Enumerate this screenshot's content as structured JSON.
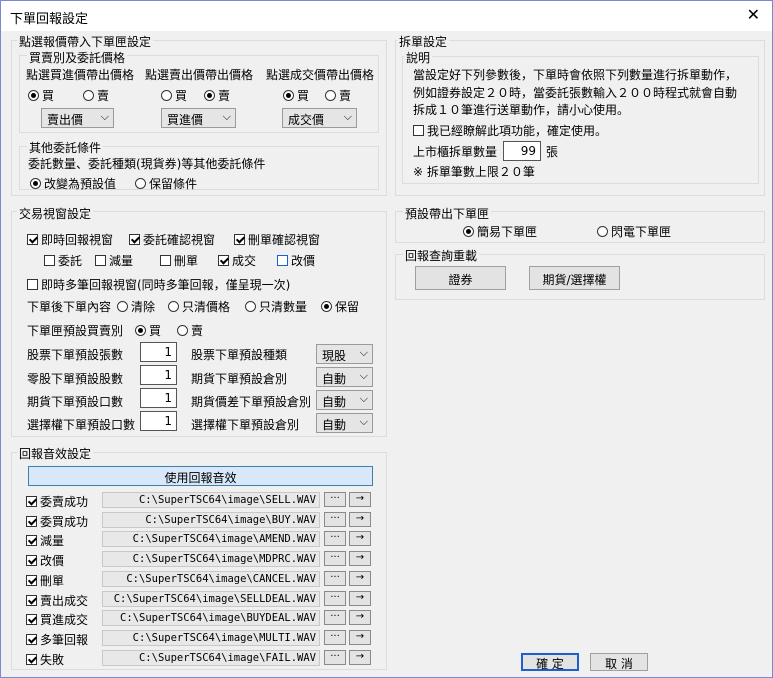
{
  "window": {
    "title": "下單回報設定",
    "close": "✕"
  },
  "quote_group": {
    "title": "點選報價帶入下單匣設定",
    "buy_sell_title": "買賣別及委託價格",
    "col1": {
      "label": "點選買進價帶出價格",
      "buy": "買",
      "sell": "賣",
      "select": "賣出價"
    },
    "col2": {
      "label": "點選賣出價帶出價格",
      "buy": "買",
      "sell": "賣",
      "select": "買進價"
    },
    "col3": {
      "label": "點選成交價帶出價格",
      "buy": "買",
      "sell": "賣",
      "select": "成交價"
    },
    "other_title": "其他委託條件",
    "other_desc": "委託數量、委託種類(現貨券)等其他委託條件",
    "opt_default": "改變為預設值",
    "opt_keep": "保留條件"
  },
  "split_group": {
    "title": "拆單設定",
    "desc_title": "說明",
    "desc_line1": "當設定好下列參數後，下單時會依照下列數量進行拆單動作，",
    "desc_line2": "例如證券設定２０時，當委託張數輸入２００時程式就會自動",
    "desc_line3": "拆成１０筆進行送單動作，請小心使用。",
    "agree": "我已經瞭解此項功能，確定使用。",
    "qty_label": "上市櫃拆單數量",
    "qty_value": "99",
    "qty_unit": "張",
    "note": "※ 拆單筆數上限２０筆"
  },
  "trade_group": {
    "title": "交易視窗設定",
    "immediate": "即時回報視窗",
    "confirm": "委託確認視窗",
    "delete_confirm": "刪單確認視窗",
    "ck_order": "委託",
    "ck_reduce": "減量",
    "ck_delete": "刪單",
    "ck_deal": "成交",
    "ck_modify": "改價",
    "multi": "即時多筆回報視窗(同時多筆回報，僅呈現一次)",
    "after_label": "下單後下單內容",
    "after_clear": "清除",
    "after_price": "只清價格",
    "after_qty": "只清數量",
    "after_keep": "保留",
    "default_side_label": "下單匣預設買賣別",
    "side_buy": "買",
    "side_sell": "賣",
    "stock_qty_label": "股票下單預設張數",
    "stock_qty": "1",
    "stock_type_label": "股票下單預設種類",
    "stock_type": "現股",
    "odd_qty_label": "零股下單預設股數",
    "odd_qty": "1",
    "fut_acct_label": "期貨下單預設倉別",
    "fut_acct": "自動",
    "fut_qty_label": "期貨下單預設口數",
    "fut_qty": "1",
    "spread_acct_label": "期貨價差下單預設倉別",
    "spread_acct": "自動",
    "opt_qty_label": "選擇權下單預設口數",
    "opt_qty": "1",
    "opt_acct_label": "選擇權下單預設倉別",
    "opt_acct": "自動"
  },
  "sound_group": {
    "title": "回報音效設定",
    "use_button": "使用回報音效",
    "browse": "···",
    "play": "→",
    "items": [
      {
        "label": "委賣成功",
        "path": "C:\\SuperTSC64\\image\\SELL.WAV"
      },
      {
        "label": "委買成功",
        "path": "C:\\SuperTSC64\\image\\BUY.WAV"
      },
      {
        "label": "減量",
        "path": "C:\\SuperTSC64\\image\\AMEND.WAV"
      },
      {
        "label": "改價",
        "path": "C:\\SuperTSC64\\image\\MDPRC.WAV"
      },
      {
        "label": "刪單",
        "path": "C:\\SuperTSC64\\image\\CANCEL.WAV"
      },
      {
        "label": "賣出成交",
        "path": "C:\\SuperTSC64\\image\\SELLDEAL.WAV"
      },
      {
        "label": "買進成交",
        "path": "C:\\SuperTSC64\\image\\BUYDEAL.WAV"
      },
      {
        "label": "多筆回報",
        "path": "C:\\SuperTSC64\\image\\MULTI.WAV"
      },
      {
        "label": "失敗",
        "path": "C:\\SuperTSC64\\image\\FAIL.WAV"
      }
    ]
  },
  "default_box_group": {
    "title": "預設帶出下單匣",
    "simple": "簡易下單匣",
    "flash": "閃電下單匣"
  },
  "reload_group": {
    "title": "回報查詢重載",
    "stock_button": "證券",
    "futopt_button": "期貨/選擇權"
  },
  "footer": {
    "ok": "確 定",
    "cancel": "取 消"
  },
  "colors": {
    "accent_border": "#1e5fd0",
    "title_bg": "#ffffff",
    "use_sound_bg": "#d8e8f8"
  }
}
